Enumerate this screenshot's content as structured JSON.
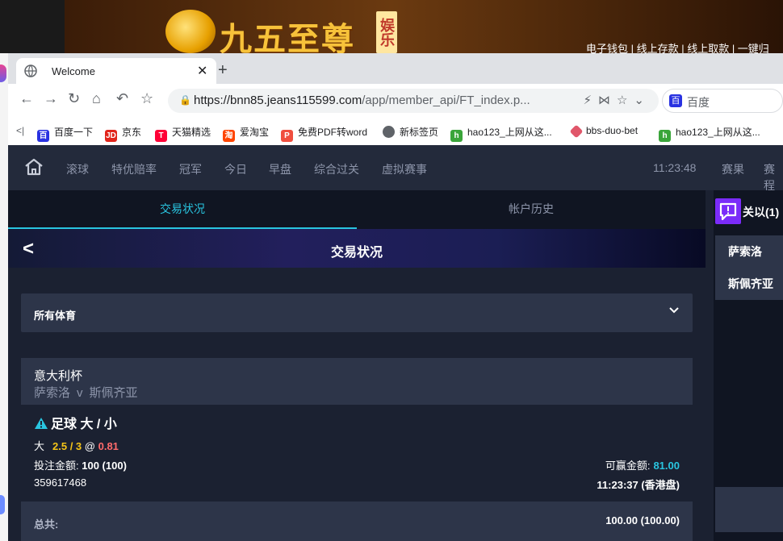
{
  "banner": {
    "logo_text": "九五至尊",
    "logo_tag": "娱乐",
    "links": "电子钱包 | 线上存款 | 线上取款 | 一键归"
  },
  "browser": {
    "tab_title": "Welcome",
    "url_host": "https://bnn85.jeans115599.com",
    "url_path": "/app/member_api/FT_index.p...",
    "search_placeholder": "百度",
    "bookmarks": [
      "百度一下",
      "京东",
      "天猫精选",
      "爱淘宝",
      "免费PDF转word",
      "新标签页",
      "hao123_上网从这...",
      "bbs-duo-bet",
      "hao123_上网从这..."
    ]
  },
  "topnav": {
    "items": [
      "滚球",
      "特优赔率",
      "冠军",
      "今日",
      "早盘",
      "综合过关",
      "虚拟赛事"
    ],
    "clock": "11:23:48",
    "right_items": [
      "赛果",
      "赛程"
    ]
  },
  "tabs": {
    "active": "交易状况",
    "inactive": "帐户历史"
  },
  "status": {
    "title": "交易状况"
  },
  "sport_select": {
    "value": "所有体育"
  },
  "bet": {
    "league": "意大利杯",
    "home": "萨索洛",
    "vs": "v",
    "away": "斯佩齐亚",
    "market": "足球 大 / 小",
    "selection": "大",
    "line": "2.5 / 3",
    "at": "@",
    "odds": "0.81",
    "stake_label": "投注金额:",
    "stake_value": "100 (100)",
    "ticket_id": "359617468",
    "win_label": "可赢金额:",
    "win_value": "81.00",
    "time": "11:23:37 (香港盘)"
  },
  "total": {
    "label": "总共:",
    "value": "100.00 (100.00)"
  },
  "side_panel": {
    "notice": "关以(1)",
    "team1": "萨索洛",
    "team2": "斯佩齐亚"
  },
  "colors": {
    "accent": "#29c5e0",
    "line_yellow": "#f5c518",
    "odds_red": "#ff6b6b",
    "panel": "#2d3549",
    "nav_bg": "#232a3b"
  }
}
